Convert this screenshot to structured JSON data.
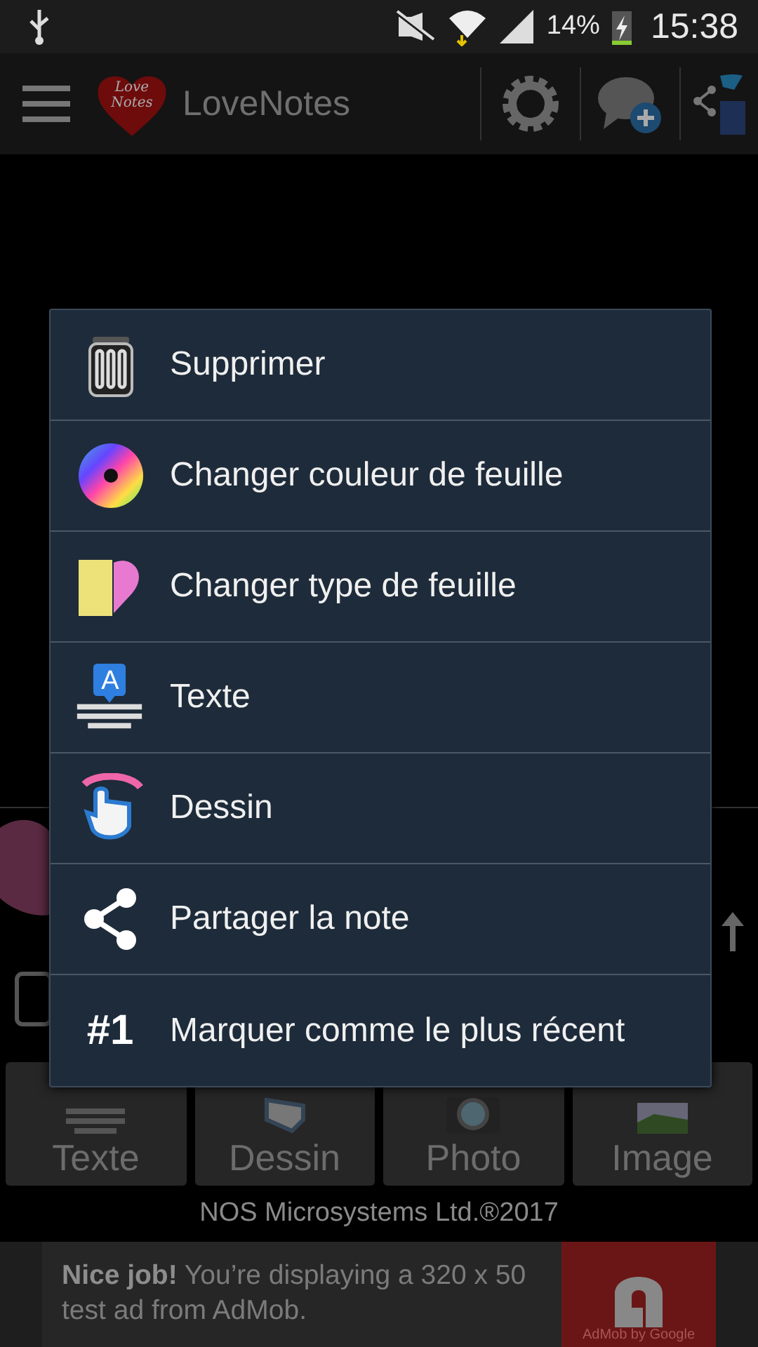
{
  "status_bar": {
    "battery": "14%",
    "time": "15:38"
  },
  "app_bar": {
    "logo_lines": [
      "Love",
      "Notes"
    ],
    "title": "LoveNotes"
  },
  "menu": {
    "items": [
      {
        "kind": "delete",
        "label": "Supprimer"
      },
      {
        "kind": "color",
        "label": "Changer couleur de feuille"
      },
      {
        "kind": "sheet",
        "label": "Changer type de feuille"
      },
      {
        "kind": "text",
        "label": "Texte",
        "glyph": "A"
      },
      {
        "kind": "draw",
        "label": "Dessin"
      },
      {
        "kind": "share",
        "label": "Partager la note"
      },
      {
        "kind": "rank",
        "label": "Marquer comme le plus récent",
        "glyph": "#1"
      }
    ]
  },
  "toolbar": [
    {
      "kind": "text",
      "label": "Texte"
    },
    {
      "kind": "draw",
      "label": "Dessin"
    },
    {
      "kind": "photo",
      "label": "Photo"
    },
    {
      "kind": "image",
      "label": "Image"
    }
  ],
  "footer": "NOS Microsystems Ltd.®2017",
  "ad": {
    "message": "**Nice job!** You’re displaying a 320 x 50 test ad from AdMob.",
    "brand": "AdMob by Google"
  }
}
